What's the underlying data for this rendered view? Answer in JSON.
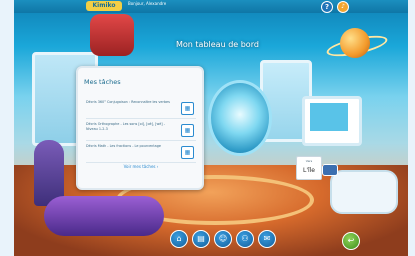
{
  "header": {
    "logo_text": "Kimiko",
    "username": "Bonjour, Alexandre"
  },
  "page_title": "Mon tableau de bord",
  "tasks": {
    "heading": "Mes tâches",
    "items": [
      {
        "text": "Décris 360° Conjugaison : Reconnaître les verbes"
      },
      {
        "text": "Décris Orthographe - Les sons [oi], [oè], [wè] - Niveau 1-2-3"
      },
      {
        "text": "Décris Math - Les fractions - Le pourcentage"
      }
    ],
    "see_all": "Voir mes tâches ›"
  },
  "tooltip": {
    "small": "Vers",
    "label": "L'île"
  },
  "icons": {
    "help": "help-icon",
    "sound": "sound-icon",
    "home": "home-icon",
    "calendar": "calendar-icon"
  },
  "colors": {
    "accent": "#2b8bd0",
    "header": "#1b8fbf"
  }
}
